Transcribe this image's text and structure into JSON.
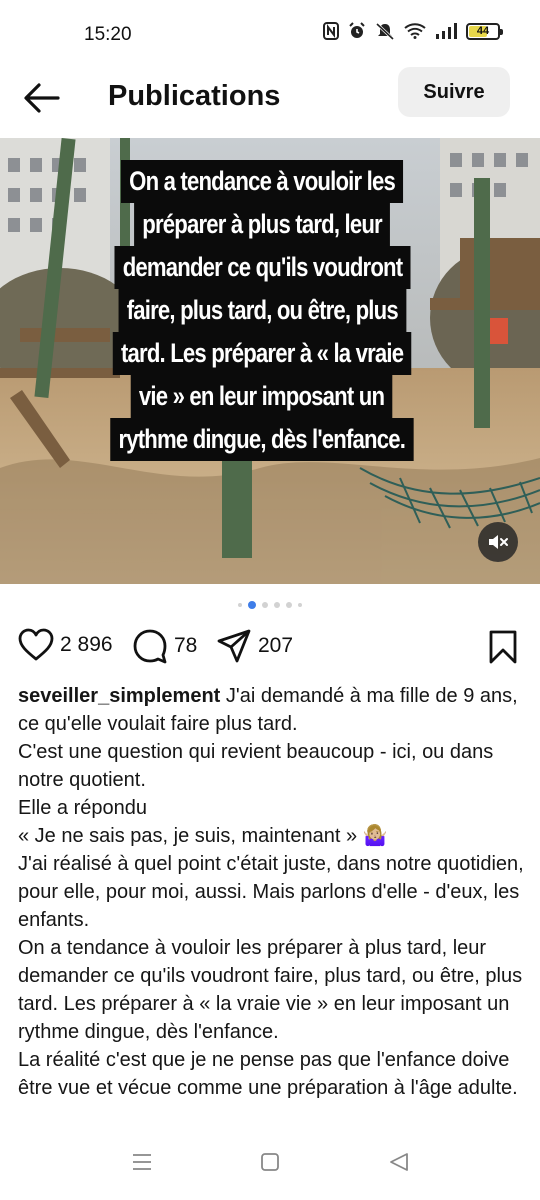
{
  "status_bar": {
    "time": "15:20",
    "battery": "44"
  },
  "header": {
    "title": "Publications",
    "follow_label": "Suivre"
  },
  "post": {
    "overlay_lines": [
      "On a tendance à vouloir les",
      "préparer à plus tard, leur",
      "demander ce qu'ils voudront",
      "faire, plus tard, ou être, plus",
      "tard. Les préparer à « la vraie",
      "vie » en leur imposant un",
      "rythme dingue, dès l'enfance."
    ],
    "carousel": {
      "count": 6,
      "active_index": 1
    }
  },
  "actions": {
    "likes": "2 896",
    "comments": "78",
    "shares": "207"
  },
  "caption": {
    "username": "seveiller_simplement",
    "paragraphs": [
      "J'ai demandé à ma fille de 9 ans, ce qu'elle voulait faire plus tard.",
      "C'est une question qui revient beaucoup - ici, ou dans notre quotient.",
      "Elle a répondu",
      "« Je ne sais pas, je suis, maintenant » 🤷🏼‍♀️",
      "J'ai réalisé à quel point c'était juste, dans notre quotidien, pour elle, pour moi, aussi. Mais parlons d'elle - d'eux, les enfants.",
      "On a tendance à vouloir les préparer à plus tard, leur demander ce qu'ils voudront faire, plus tard, ou être, plus tard. Les préparer à « la vraie vie » en leur imposant un rythme dingue, dès l'enfance.",
      "La réalité c'est que je ne pense pas que l'enfance doive être vue et vécue comme une préparation à l'âge adulte."
    ]
  },
  "colors": {
    "accent_dot": "#3f7de8",
    "follow_bg": "#efefef"
  }
}
